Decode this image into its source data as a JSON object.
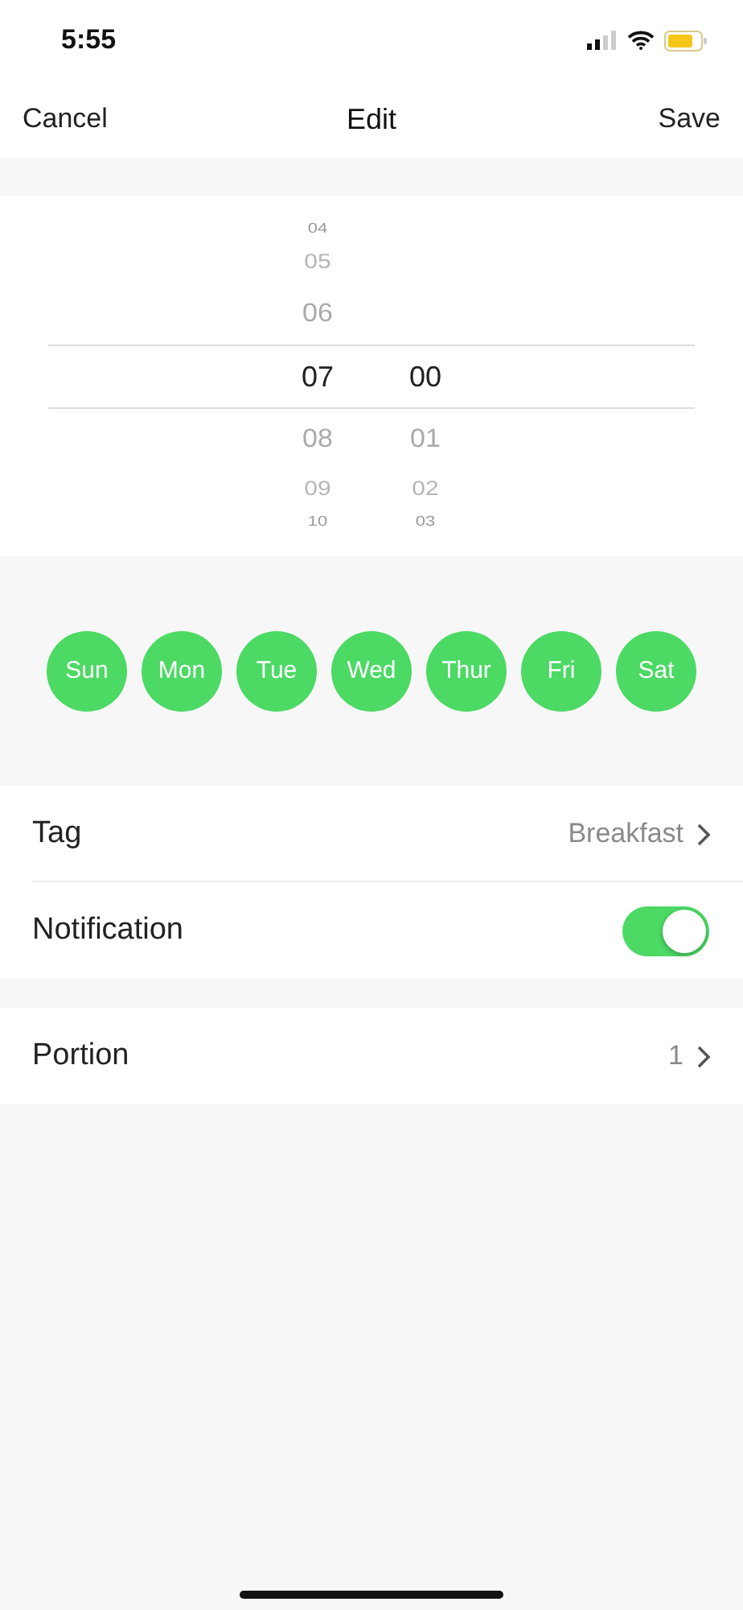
{
  "status_bar": {
    "time": "5:55"
  },
  "nav": {
    "cancel": "Cancel",
    "title": "Edit",
    "save": "Save"
  },
  "time_picker": {
    "columns": [
      {
        "items": [
          {
            "label": "04",
            "selected": false
          },
          {
            "label": "05",
            "selected": false
          },
          {
            "label": "06",
            "selected": false
          },
          {
            "label": "07",
            "selected": true
          },
          {
            "label": "08",
            "selected": false
          },
          {
            "label": "09",
            "selected": false
          },
          {
            "label": "10",
            "selected": false
          }
        ]
      },
      {
        "items": [
          {
            "label": "00",
            "selected": true
          },
          {
            "label": "01",
            "selected": false
          },
          {
            "label": "02",
            "selected": false
          },
          {
            "label": "03",
            "selected": false
          }
        ]
      }
    ]
  },
  "days": [
    {
      "label": "Sun",
      "selected": true
    },
    {
      "label": "Mon",
      "selected": true
    },
    {
      "label": "Tue",
      "selected": true
    },
    {
      "label": "Wed",
      "selected": true
    },
    {
      "label": "Thur",
      "selected": true
    },
    {
      "label": "Fri",
      "selected": true
    },
    {
      "label": "Sat",
      "selected": true
    }
  ],
  "settings_groups": [
    [
      {
        "kind": "link",
        "label": "Tag",
        "value": "Breakfast"
      },
      {
        "kind": "toggle",
        "label": "Notification",
        "on": true
      }
    ],
    [
      {
        "kind": "link",
        "label": "Portion",
        "value": "1"
      }
    ]
  ]
}
